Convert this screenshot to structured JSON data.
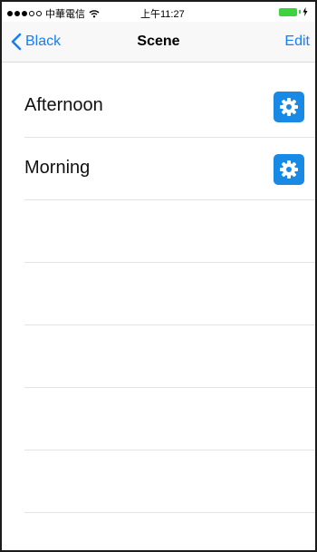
{
  "status_bar": {
    "carrier": "中華電信",
    "time": "上午11:27",
    "signal_dots": 5,
    "signal_filled": 3,
    "battery_color": "#3dd33d"
  },
  "nav": {
    "back_label": "Black",
    "title": "Scene",
    "edit_label": "Edit",
    "accent_color": "#157efb"
  },
  "scenes": [
    {
      "label": "Afternoon",
      "icon": "gear-icon"
    },
    {
      "label": "Morning",
      "icon": "gear-icon"
    }
  ],
  "empty_rows": 6,
  "gear_color": "#1889e5"
}
